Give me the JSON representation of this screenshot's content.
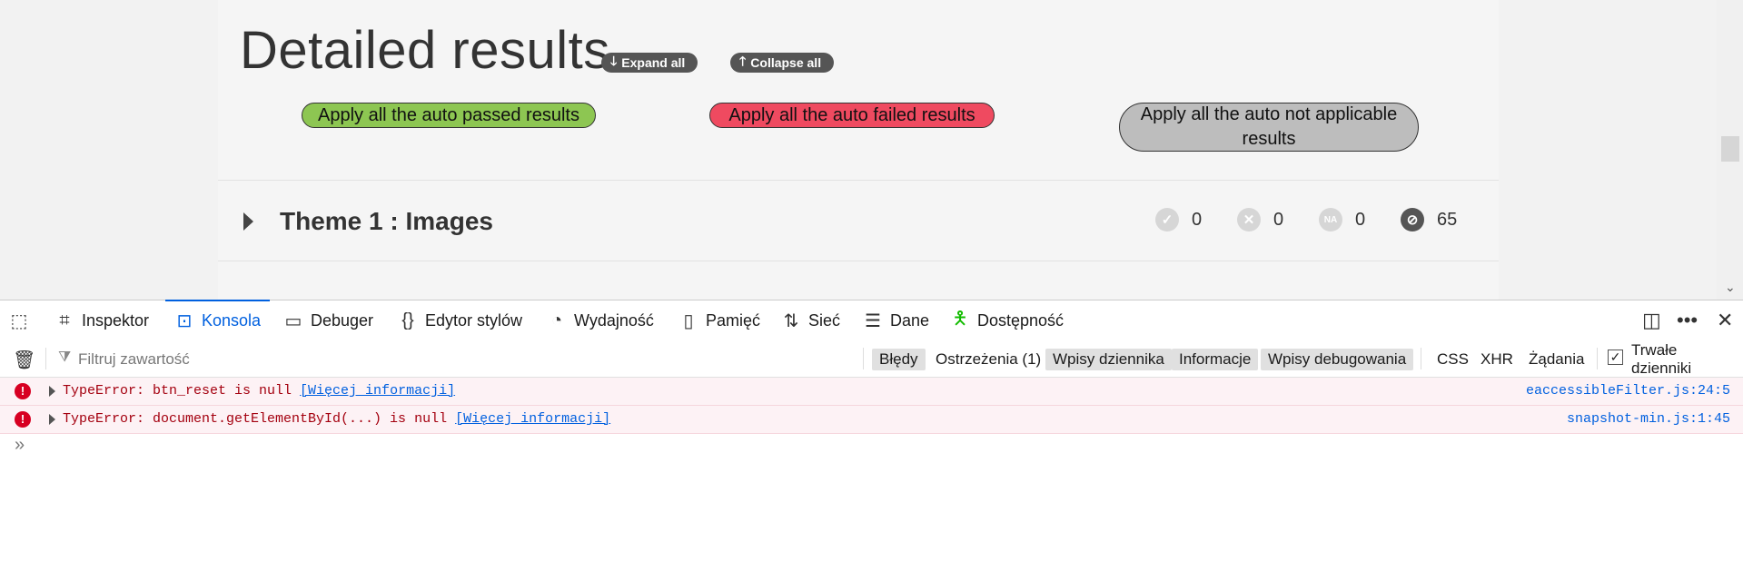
{
  "page": {
    "title": "Detailed results",
    "expand_label": "Expand all",
    "collapse_label": "Collapse all",
    "apply_passed": "Apply all the auto passed results",
    "apply_failed": "Apply all the auto failed results",
    "apply_na": "Apply all the auto not applicable results",
    "colors": {
      "passed": "#8dc652",
      "failed": "#ef4a60",
      "na": "#bdbdbd"
    },
    "themes": [
      {
        "title": "Theme 1 : Images",
        "passed": "0",
        "failed": "0",
        "na": "0",
        "untested": "65"
      }
    ]
  },
  "devtools": {
    "tabs": [
      {
        "label": "Inspektor",
        "icon": "inspector-icon"
      },
      {
        "label": "Konsola",
        "icon": "console-icon",
        "active": true
      },
      {
        "label": "Debuger",
        "icon": "debugger-icon"
      },
      {
        "label": "Edytor stylów",
        "icon": "style-editor-icon"
      },
      {
        "label": "Wydajność",
        "icon": "performance-icon"
      },
      {
        "label": "Pamięć",
        "icon": "memory-icon"
      },
      {
        "label": "Sieć",
        "icon": "network-icon"
      },
      {
        "label": "Dane",
        "icon": "storage-icon"
      },
      {
        "label": "Dostępność",
        "icon": "accessibility-icon"
      }
    ],
    "filter_placeholder": "Filtruj zawartość",
    "filters": {
      "errors": "Błędy",
      "warnings": "Ostrzeżenia (1)",
      "logs": "Wpisy dziennika",
      "info": "Informacje",
      "debug": "Wpisy debugowania",
      "css": "CSS",
      "xhr": "XHR",
      "requests": "Żądania",
      "persist": "Trwałe dzienniki"
    },
    "messages": [
      {
        "text": "TypeError: btn_reset is null ",
        "more": "[Więcej informacji]",
        "source": "eaccessibleFilter.js:24:5"
      },
      {
        "text": "TypeError: document.getElementById(...) is null ",
        "more": "[Więcej informacji]",
        "source": "snapshot-min.js:1:45"
      }
    ]
  }
}
